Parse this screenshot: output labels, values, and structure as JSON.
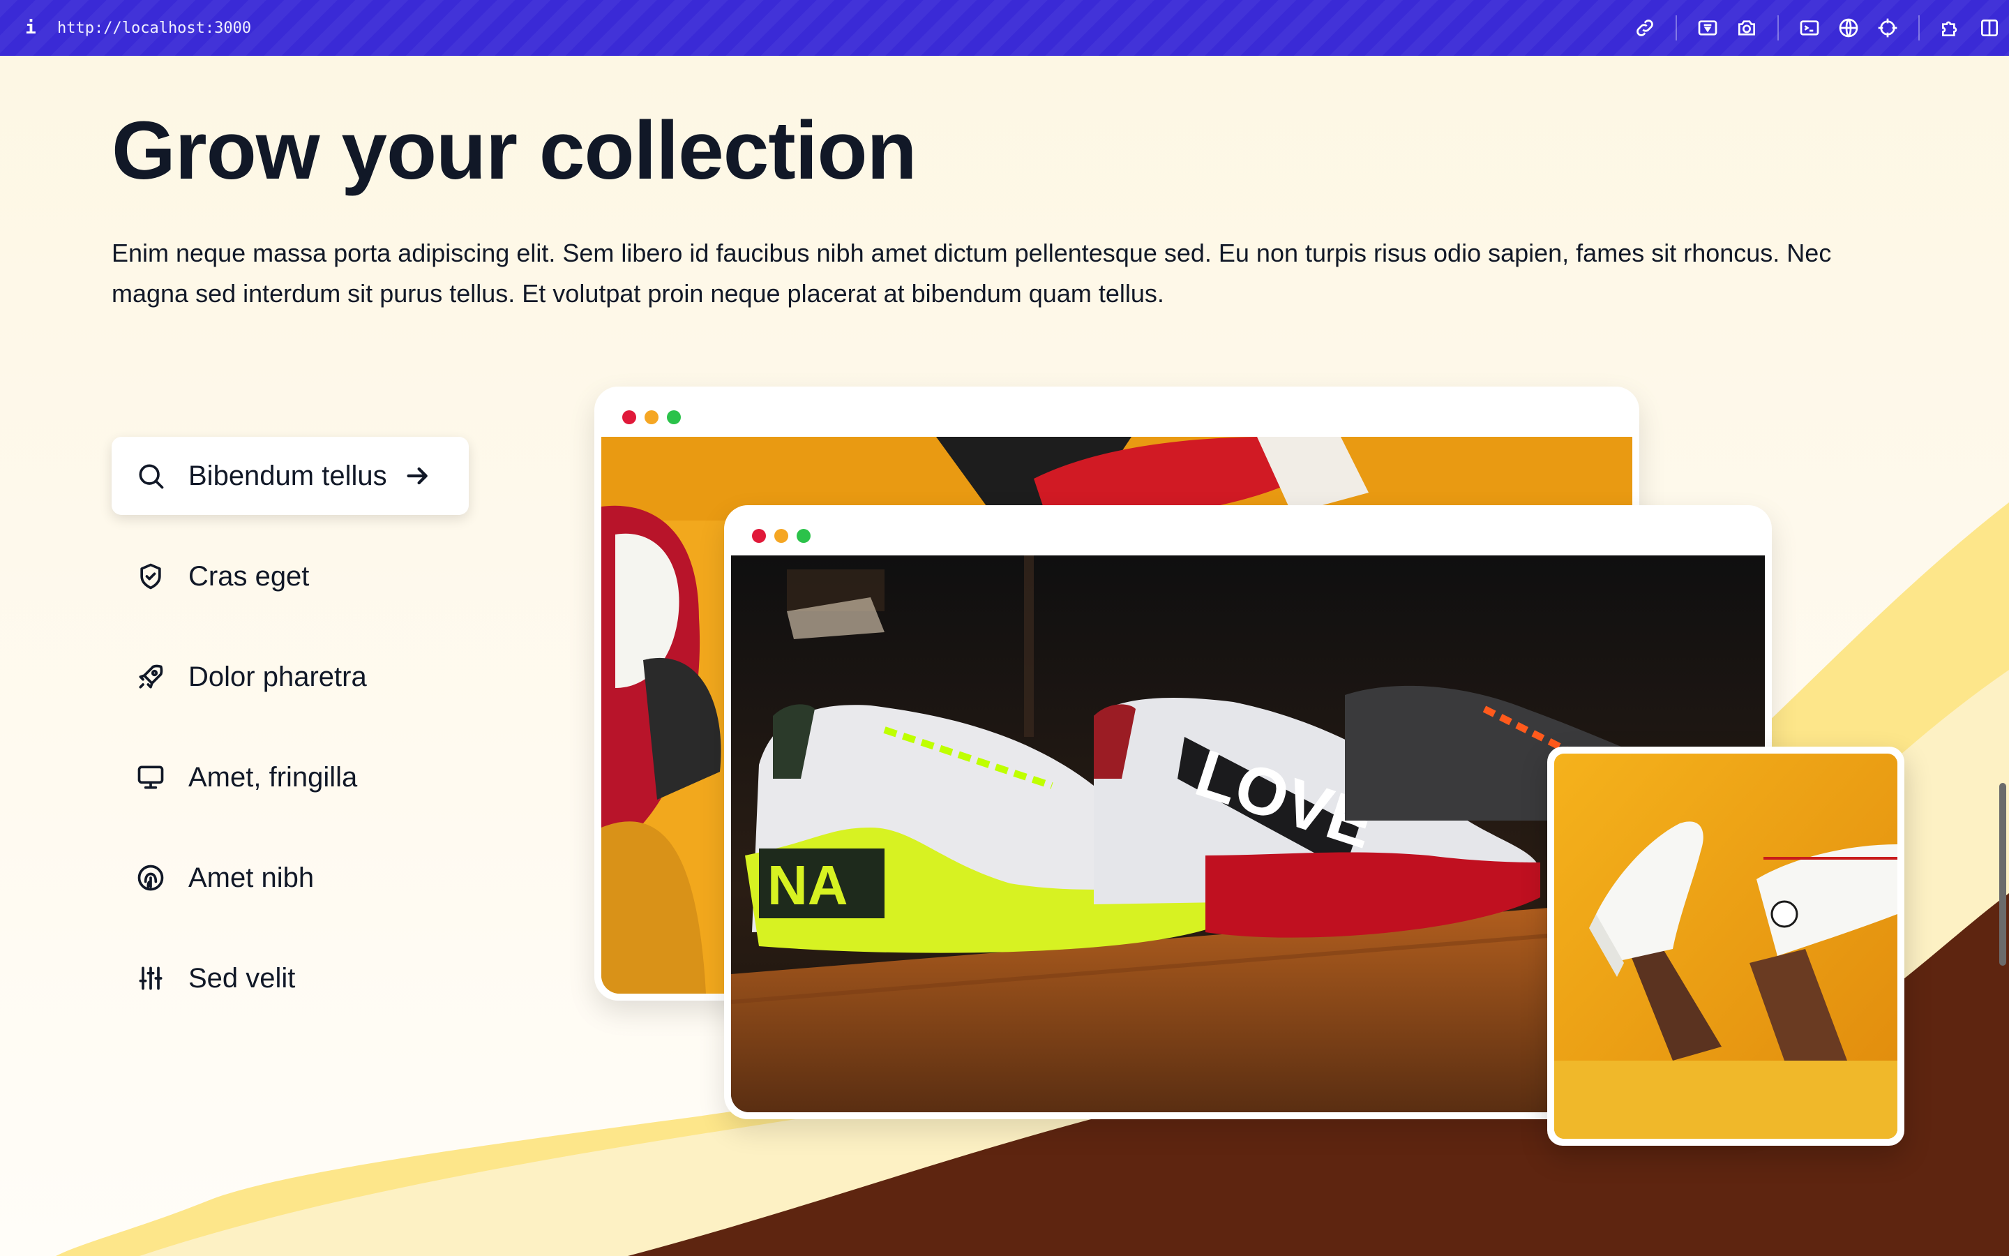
{
  "browser": {
    "url": "http://localhost:3000",
    "info_icon": "i",
    "tools": [
      "link-icon",
      "inspect-icon",
      "camera-icon",
      "terminal-icon",
      "globe-icon",
      "crosshair-icon",
      "extension-icon",
      "sidebar-icon"
    ]
  },
  "hero": {
    "title": "Grow your collection",
    "lead": "Enim neque massa porta adipiscing elit. Sem libero id faucibus nibh amet dictum pellentesque sed. Eu non turpis risus odio sapien, fames sit rhoncus. Nec magna sed interdum sit purus tellus. Et volutpat proin neque placerat at bibendum quam tellus."
  },
  "features": [
    {
      "label": "Bibendum tellus",
      "icon": "search-icon",
      "active": true
    },
    {
      "label": "Cras eget",
      "icon": "shield-check-icon",
      "active": false
    },
    {
      "label": "Dolor pharetra",
      "icon": "rocket-icon",
      "active": false
    },
    {
      "label": "Amet, fringilla",
      "icon": "monitor-icon",
      "active": false
    },
    {
      "label": "Amet nibh",
      "icon": "fingerprint-icon",
      "active": false
    },
    {
      "label": "Sed velit",
      "icon": "sliders-icon",
      "active": false
    }
  ],
  "window_dots": {
    "red": "#e0193a",
    "yellow": "#f5a623",
    "green": "#2bc24a"
  },
  "colors": {
    "topbar": "#3a2ad6",
    "background": "#fdf7e6",
    "wave_light": "#fde68a",
    "wave_pale": "#fdf1c4",
    "wave_dark": "#5e2510",
    "image_orange": "#f2a81d"
  }
}
